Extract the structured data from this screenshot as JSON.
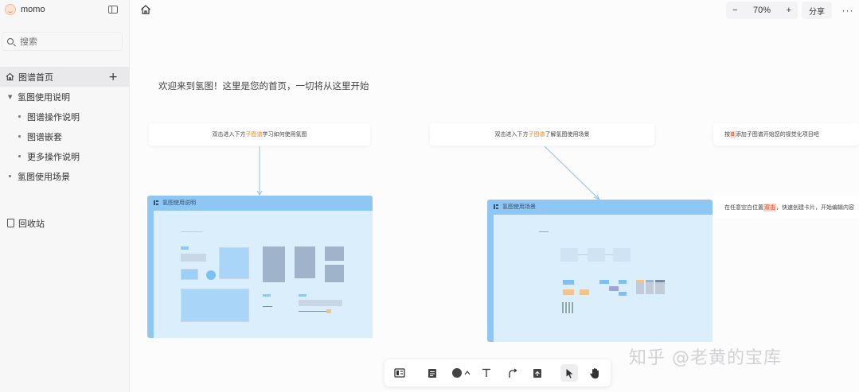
{
  "app": {
    "name": "momo"
  },
  "sidebar": {
    "search_placeholder": "搜索",
    "nav": [
      {
        "label": "图谱首页"
      },
      {
        "label": "氢图使用说明"
      },
      {
        "label": "图谱操作说明"
      },
      {
        "label": "图谱嵌套"
      },
      {
        "label": "更多操作说明"
      },
      {
        "label": "氢图使用场景"
      }
    ],
    "trash_label": "回收站"
  },
  "topbar": {
    "zoom_out": "−",
    "zoom_level": "70%",
    "zoom_in": "+",
    "share_label": "分享",
    "more_label": "···"
  },
  "canvas": {
    "welcome": "欢迎来到氢图！这里是您的首页，一切将从这里开始",
    "hint1": {
      "pre": "双击进入下方",
      "kw": "子图谱",
      "post": "学习如何使用氢图"
    },
    "hint2": {
      "pre": "双击进入下方",
      "kw": "子图谱",
      "post": "了解氢图使用场景"
    },
    "hint3": {
      "pre": "按",
      "kw": "B",
      "post": "添加子图谱开始您的视觉化项目吧"
    },
    "hint4": {
      "pre": "在任意空白位置",
      "kw": "双击",
      "post": "，快速创建卡片，开始编辑内容"
    },
    "card1_title": "氢图使用说明",
    "card2_title": "氢图使用场景"
  },
  "toolbar": {
    "tools": [
      "layout-icon",
      "note-icon",
      "shape-icon",
      "text-icon",
      "connector-icon",
      "upload-icon",
      "pointer-icon",
      "hand-icon"
    ]
  },
  "watermark": "知乎 @老黄的宝库"
}
